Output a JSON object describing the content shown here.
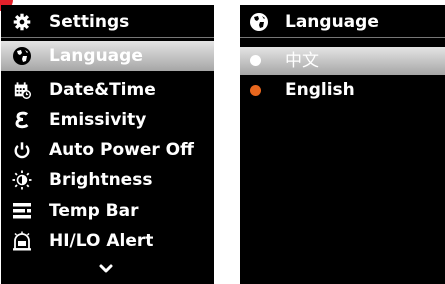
{
  "settings_menu": {
    "title": "Settings",
    "items": [
      {
        "label": "Language",
        "icon": "globe-icon",
        "selected": true
      },
      {
        "label": "Date&Time",
        "icon": "calendar-clock-icon",
        "selected": false
      },
      {
        "label": "Emissivity",
        "icon": "epsilon-icon",
        "selected": false
      },
      {
        "label": "Auto Power Off",
        "icon": "power-icon",
        "selected": false
      },
      {
        "label": "Brightness",
        "icon": "brightness-icon",
        "selected": false
      },
      {
        "label": "Temp Bar",
        "icon": "temp-bar-icon",
        "selected": false
      },
      {
        "label": "HI/LO Alert",
        "icon": "alarm-icon",
        "selected": false
      }
    ],
    "more_indicator": "chevron-down-icon"
  },
  "language_menu": {
    "title": "Language",
    "options": [
      {
        "label": "中文",
        "selected": false,
        "dot_color": "#ffffff"
      },
      {
        "label": "English",
        "selected": true,
        "dot_color": "#e8671e"
      }
    ]
  },
  "colors": {
    "background": "#000000",
    "text": "#ffffff",
    "highlight": "#c8c8c8",
    "active_dot": "#e8671e",
    "indicator": "#e3202a"
  }
}
